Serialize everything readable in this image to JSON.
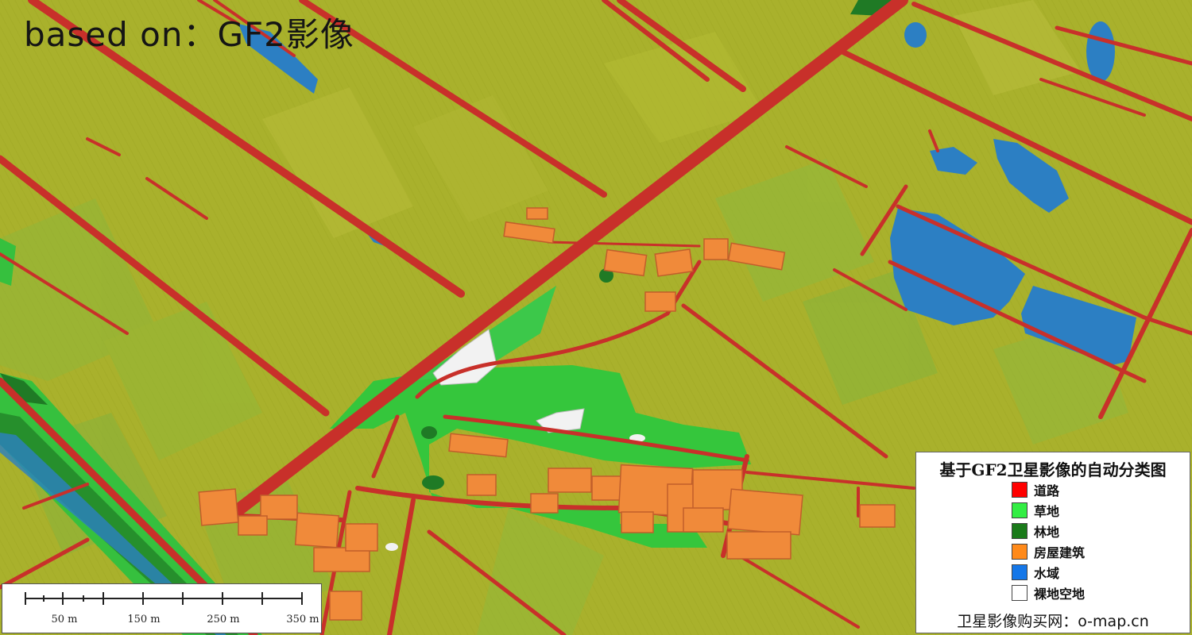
{
  "watermark": "based on：GF2影像",
  "legend": {
    "title": "基于GF2卫星影像的自动分类图",
    "items": [
      {
        "label": "道路",
        "color": "#ff0000"
      },
      {
        "label": "草地",
        "color": "#33ee44"
      },
      {
        "label": "林地",
        "color": "#1a7a1a"
      },
      {
        "label": "房屋建筑",
        "color": "#ff8a1a"
      },
      {
        "label": "水域",
        "color": "#1577e8"
      },
      {
        "label": "裸地空地",
        "color": "#ffffff"
      }
    ],
    "footer": "卫星影像购买网：o-map.cn"
  },
  "scalebar": {
    "labels": [
      "50 m",
      "150 m",
      "250 m",
      "350 m"
    ]
  },
  "colors": {
    "farmland": "#a9b12c",
    "road": "#c8302a",
    "grass": "#38c23c",
    "forest": "#1f7a25",
    "building": "#f08a3a",
    "water": "#2c7fc3",
    "bare": "#f2f2f2"
  }
}
